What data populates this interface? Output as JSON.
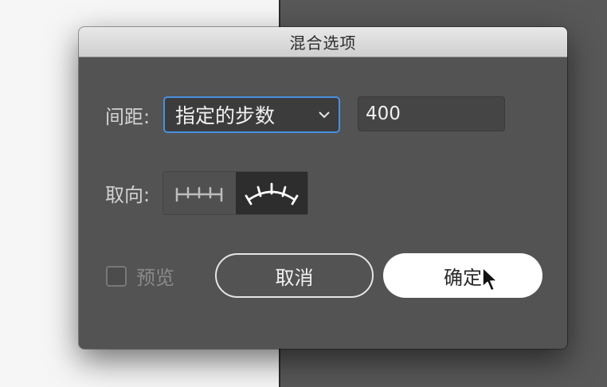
{
  "dialog": {
    "title": "混合选项",
    "spacing": {
      "label": "间距:",
      "mode": "指定的步数",
      "value": "400"
    },
    "orientation": {
      "label": "取向:",
      "options": [
        {
          "icon": "align-to-page-icon",
          "selected": false
        },
        {
          "icon": "align-to-path-icon",
          "selected": true
        }
      ]
    },
    "preview": {
      "label": "预览",
      "checked": false
    },
    "buttons": {
      "cancel": "取消",
      "ok": "确定"
    }
  },
  "colors": {
    "dialog_bg": "#535353",
    "focus_ring": "#4a8fe0",
    "selected_segment": "#2d2d2d"
  }
}
